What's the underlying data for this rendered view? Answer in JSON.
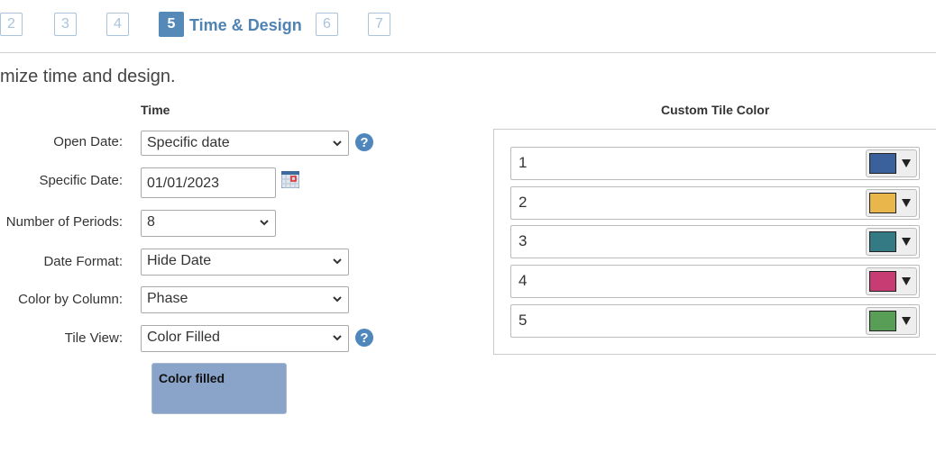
{
  "steps": [
    {
      "n": "2"
    },
    {
      "n": "3"
    },
    {
      "n": "4"
    },
    {
      "n": "5",
      "label": "Time & Design",
      "active": true
    },
    {
      "n": "6"
    },
    {
      "n": "7"
    }
  ],
  "intro": "mize time and design.",
  "time": {
    "header": "Time",
    "open_date": {
      "label": "Open Date:",
      "value": "Specific date"
    },
    "specific_date": {
      "label": "Specific Date:",
      "value": "01/01/2023"
    },
    "periods": {
      "label": "Number of Periods:",
      "value": "8"
    },
    "date_format": {
      "label": "Date Format:",
      "value": "Hide Date"
    },
    "color_by": {
      "label": "Color by Column:",
      "value": "Phase"
    },
    "tile_view": {
      "label": "Tile View:",
      "value": "Color Filled"
    },
    "preview": "Color filled",
    "preview_color": "#8aa3c8"
  },
  "custom": {
    "header": "Custom Tile Color",
    "rows": [
      {
        "value": "1",
        "color": "#3a619b"
      },
      {
        "value": "2",
        "color": "#e8b64a"
      },
      {
        "value": "3",
        "color": "#337a84"
      },
      {
        "value": "4",
        "color": "#c73d73"
      },
      {
        "value": "5",
        "color": "#589e57"
      }
    ]
  }
}
